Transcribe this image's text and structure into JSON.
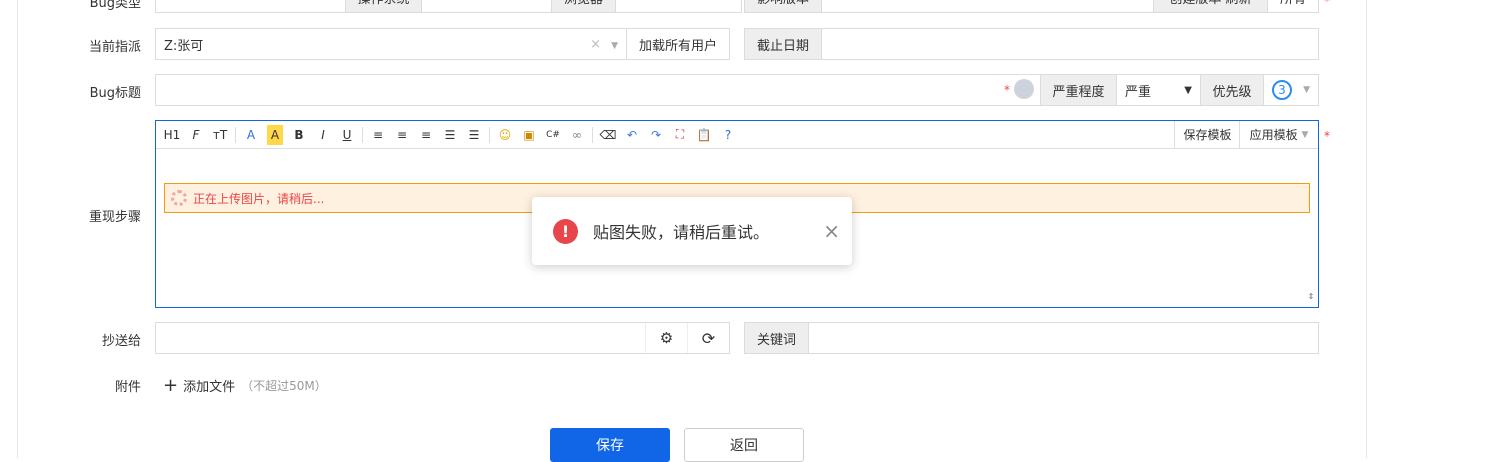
{
  "row0": {
    "label": "Bug类型",
    "os_label": "操作系统",
    "browser_label": "浏览器",
    "affected_version_label": "影响版本",
    "created_version_label": "创建版本 刷新",
    "all_label": "所有"
  },
  "assign": {
    "label": "当前指派",
    "value": "Z:张可",
    "load_all": "加载所有用户",
    "deadline_label": "截止日期"
  },
  "title": {
    "label": "Bug标题",
    "severity_label": "严重程度",
    "severity_value": "严重",
    "priority_label": "优先级",
    "priority_value": "3"
  },
  "steps": {
    "label": "重现步骤",
    "save_template": "保存模板",
    "apply_template": "应用模板",
    "uploading": "正在上传图片，请稍后...",
    "toolbar": [
      "H1",
      "F",
      "тT",
      "A",
      "A",
      "B",
      "I",
      "U"
    ]
  },
  "toast": {
    "message": "贴图失败，请稍后重试。",
    "close": "×"
  },
  "cc": {
    "label": "抄送给",
    "keywords_label": "关键词"
  },
  "attach": {
    "label": "附件",
    "add": "添加文件",
    "limit": "（不超过50M）"
  },
  "buttons": {
    "save": "保存",
    "back": "返回"
  },
  "colors": {
    "primary": "#1066e6",
    "required": "#e44",
    "error": "#e8464b"
  }
}
